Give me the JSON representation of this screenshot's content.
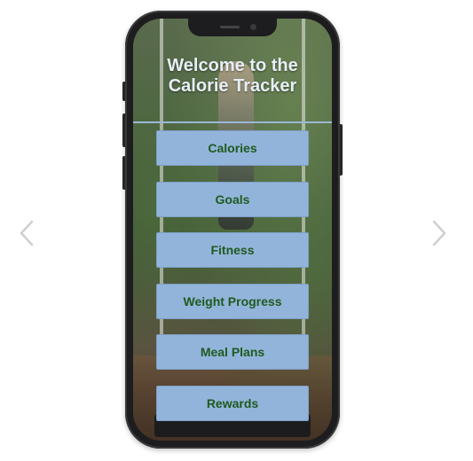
{
  "app": {
    "title": "Welcome to the\nCalorie Tracker"
  },
  "menu": {
    "items": [
      {
        "label": "Calories"
      },
      {
        "label": "Goals"
      },
      {
        "label": "Fitness"
      },
      {
        "label": "Weight Progress"
      },
      {
        "label": "Meal Plans"
      },
      {
        "label": "Rewards"
      }
    ]
  },
  "carousel": {
    "prev_icon": "chevron-left-icon",
    "next_icon": "chevron-right-icon"
  },
  "colors": {
    "button_bg": "#93b4da",
    "button_text": "#1f5a1f",
    "title_text": "#e8eef8",
    "divider": "#9bb7d6",
    "arrow": "#cfcfcf"
  }
}
